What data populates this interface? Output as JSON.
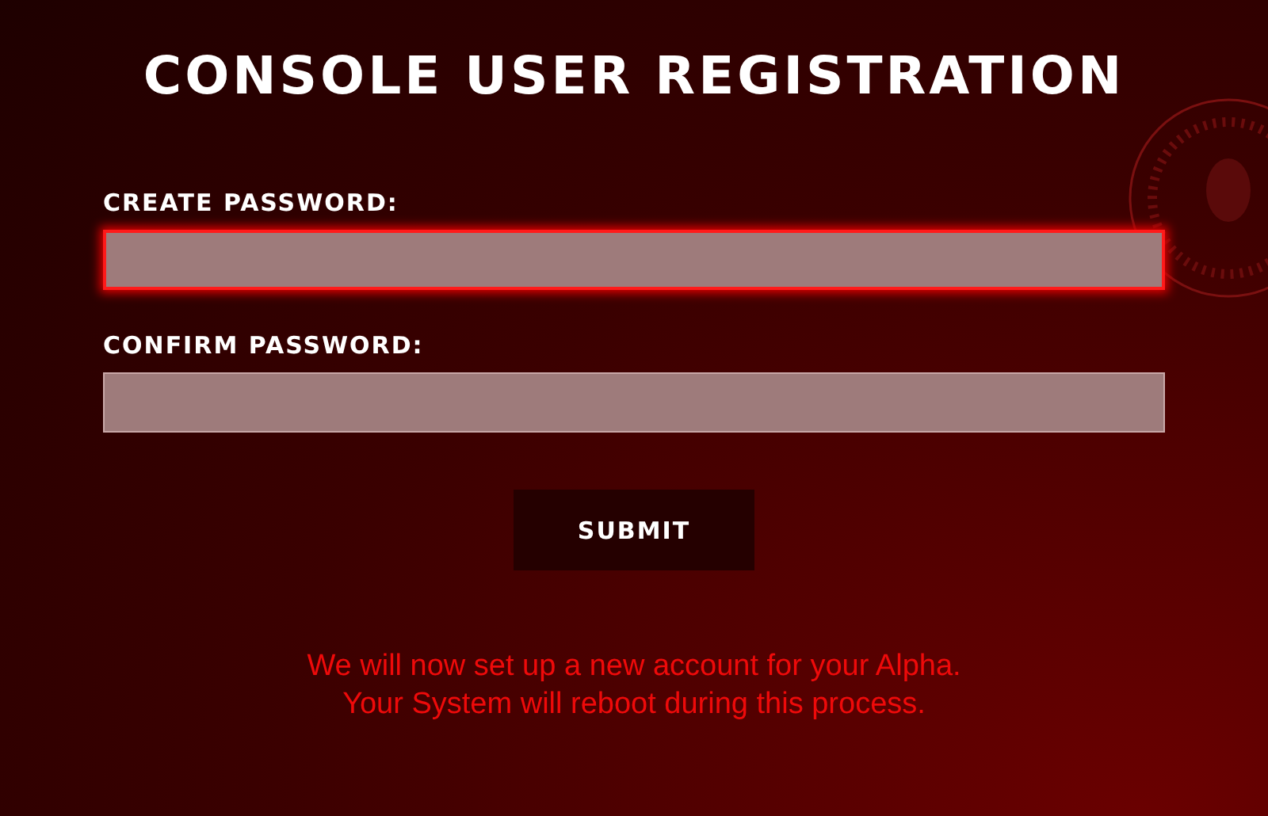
{
  "title": "CONSOLE USER REGISTRATION",
  "fields": [
    {
      "label": "CREATE PASSWORD:",
      "focused": true
    },
    {
      "label": "CONFIRM PASSWORD:",
      "focused": false
    }
  ],
  "submit": "SUBMIT",
  "notice": [
    "We will now set up a new account for your Alpha.",
    "Your System will reboot during this process."
  ]
}
